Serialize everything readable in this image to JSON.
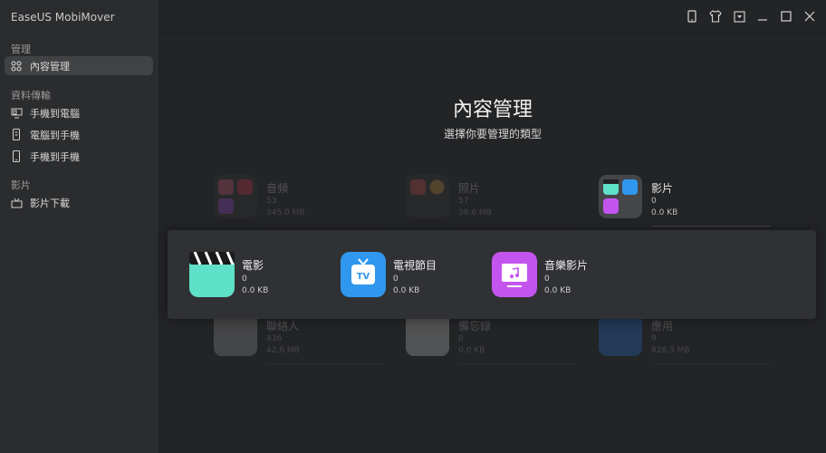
{
  "app": {
    "title": "EaseUS MobiMover"
  },
  "sidebar": {
    "sections": [
      {
        "label": "管理",
        "items": [
          {
            "label": "內容管理",
            "icon": "grid-icon",
            "active": true
          }
        ]
      },
      {
        "label": "資料傳輸",
        "items": [
          {
            "label": "手機到電腦",
            "icon": "phone-to-pc-icon"
          },
          {
            "label": "電腦到手機",
            "icon": "pc-to-phone-icon"
          },
          {
            "label": "手機到手機",
            "icon": "phone-to-phone-icon"
          }
        ]
      },
      {
        "label": "影片",
        "items": [
          {
            "label": "影片下載",
            "icon": "video-download-icon"
          }
        ]
      }
    ]
  },
  "window_controls": [
    "device-icon",
    "tshirt-icon",
    "dropdown-icon",
    "minimize-icon",
    "maximize-icon",
    "close-icon"
  ],
  "main": {
    "title": "內容管理",
    "subtitle": "選擇你要管理的類型",
    "categories": [
      {
        "name": "音頻",
        "count": "53",
        "size": "345.0 MB",
        "icon": "audio-icon"
      },
      {
        "name": "照片",
        "count": "57",
        "size": "36.6 MB",
        "icon": "photos-icon"
      },
      {
        "name": "影片",
        "count": "0",
        "size": "0.0 KB",
        "icon": "videos-icon"
      },
      {
        "name": "聯絡人",
        "count": "436",
        "size": "42.6 MB",
        "icon": "contacts-icon"
      },
      {
        "name": "備忘錄",
        "count": "0",
        "size": "0.0 KB",
        "icon": "notes-icon"
      },
      {
        "name": "應用",
        "count": "9",
        "size": "828.3 MB",
        "icon": "apps-icon"
      }
    ],
    "video_subtypes": [
      {
        "name": "電影",
        "count": "0",
        "size": "0.0 KB",
        "icon": "movie-clapper-icon",
        "color": "#5fe0c8"
      },
      {
        "name": "電視節目",
        "count": "0",
        "size": "0.0 KB",
        "icon": "tv-icon",
        "color": "#2f97ee"
      },
      {
        "name": "音樂影片",
        "count": "0",
        "size": "0.0 KB",
        "icon": "music-video-icon",
        "color": "#c355ee"
      }
    ]
  }
}
